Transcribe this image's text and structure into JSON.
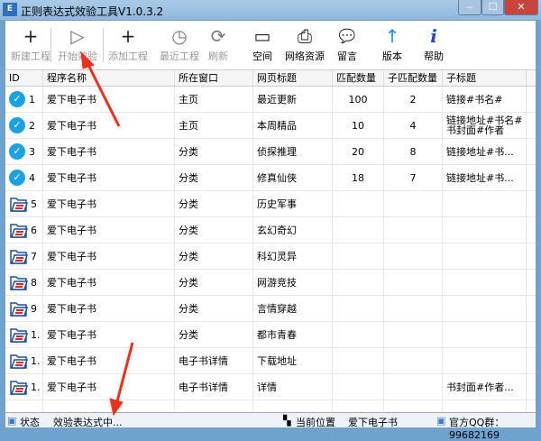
{
  "window": {
    "title": "正则表达式效验工具V1.0.3.2",
    "icon": "app-logo-icon",
    "minimize": "‒",
    "maximize": "☐",
    "close": "✕"
  },
  "toolbar": [
    {
      "label": "新建工程",
      "icon": "plus-icon",
      "glyph": "+",
      "enabled": false
    },
    {
      "label": "开始效验",
      "icon": "play-circle-icon",
      "glyph": "▷",
      "enabled": false
    },
    {
      "label": "添加工程",
      "icon": "plus-icon",
      "glyph": "+",
      "enabled": false
    },
    {
      "label": "最近工程",
      "icon": "clock-icon",
      "glyph": "◷",
      "enabled": false
    },
    {
      "label": "刷新",
      "icon": "refresh-icon",
      "glyph": "⟳",
      "enabled": false
    },
    {
      "label": "空间",
      "icon": "folder-icon",
      "glyph": "▭",
      "enabled": true
    },
    {
      "label": "网络资源",
      "icon": "printer-icon",
      "glyph": "⎙",
      "enabled": true
    },
    {
      "label": "留言",
      "icon": "chat-bubble-icon",
      "glyph": "💬",
      "enabled": true
    },
    {
      "label": "版本",
      "icon": "arrow-up-icon",
      "glyph": "↑",
      "enabled": true
    },
    {
      "label": "帮助",
      "icon": "info-icon",
      "glyph": "i",
      "enabled": true
    }
  ],
  "table": {
    "columns": [
      "ID",
      "程序名称",
      "所在窗口",
      "网页标题",
      "匹配数量",
      "子匹配数量",
      "子标题"
    ],
    "rows": [
      {
        "icon": "check",
        "id": "1",
        "name": "爱下电子书",
        "window": "主页",
        "title": "最近更新",
        "match": "100",
        "sub": "2",
        "subtitle": "链接#书名#"
      },
      {
        "icon": "check",
        "id": "2",
        "name": "爱下电子书",
        "window": "主页",
        "title": "本周精品",
        "match": "10",
        "sub": "4",
        "subtitle": "链接地址#书名#\n书封面#作者"
      },
      {
        "icon": "check",
        "id": "3",
        "name": "爱下电子书",
        "window": "分类",
        "title": "侦探推理",
        "match": "20",
        "sub": "8",
        "subtitle": "链接地址#书..."
      },
      {
        "icon": "check",
        "id": "4",
        "name": "爱下电子书",
        "window": "分类",
        "title": "修真仙侠",
        "match": "18",
        "sub": "7",
        "subtitle": "链接地址#书..."
      },
      {
        "icon": "folder",
        "id": "5",
        "name": "爱下电子书",
        "window": "分类",
        "title": "历史军事",
        "match": "",
        "sub": "",
        "subtitle": ""
      },
      {
        "icon": "folder",
        "id": "6",
        "name": "爱下电子书",
        "window": "分类",
        "title": "玄幻奇幻",
        "match": "",
        "sub": "",
        "subtitle": ""
      },
      {
        "icon": "folder",
        "id": "7",
        "name": "爱下电子书",
        "window": "分类",
        "title": "科幻灵异",
        "match": "",
        "sub": "",
        "subtitle": ""
      },
      {
        "icon": "folder",
        "id": "8",
        "name": "爱下电子书",
        "window": "分类",
        "title": "网游竞技",
        "match": "",
        "sub": "",
        "subtitle": ""
      },
      {
        "icon": "folder",
        "id": "9",
        "name": "爱下电子书",
        "window": "分类",
        "title": "言情穿越",
        "match": "",
        "sub": "",
        "subtitle": ""
      },
      {
        "icon": "folder",
        "id": "1.",
        "name": "爱下电子书",
        "window": "分类",
        "title": "都市青春",
        "match": "",
        "sub": "",
        "subtitle": ""
      },
      {
        "icon": "folder",
        "id": "1.",
        "name": "爱下电子书",
        "window": "电子书详情",
        "title": "下载地址",
        "match": "",
        "sub": "",
        "subtitle": ""
      },
      {
        "icon": "folder",
        "id": "1.",
        "name": "爱下电子书",
        "window": "电子书详情",
        "title": "详情",
        "match": "",
        "sub": "",
        "subtitle": "书封面#作者..."
      }
    ]
  },
  "statusbar": {
    "status_label": "状态",
    "status_value": "效验表达式中...",
    "location_label": "当前位置",
    "location_value": "爱下电子书",
    "qq": "官方QQ群：99682169"
  },
  "colors": {
    "check": "#1ba1e2",
    "arrow": "#e8321e",
    "folder": "#1e4f9c"
  }
}
